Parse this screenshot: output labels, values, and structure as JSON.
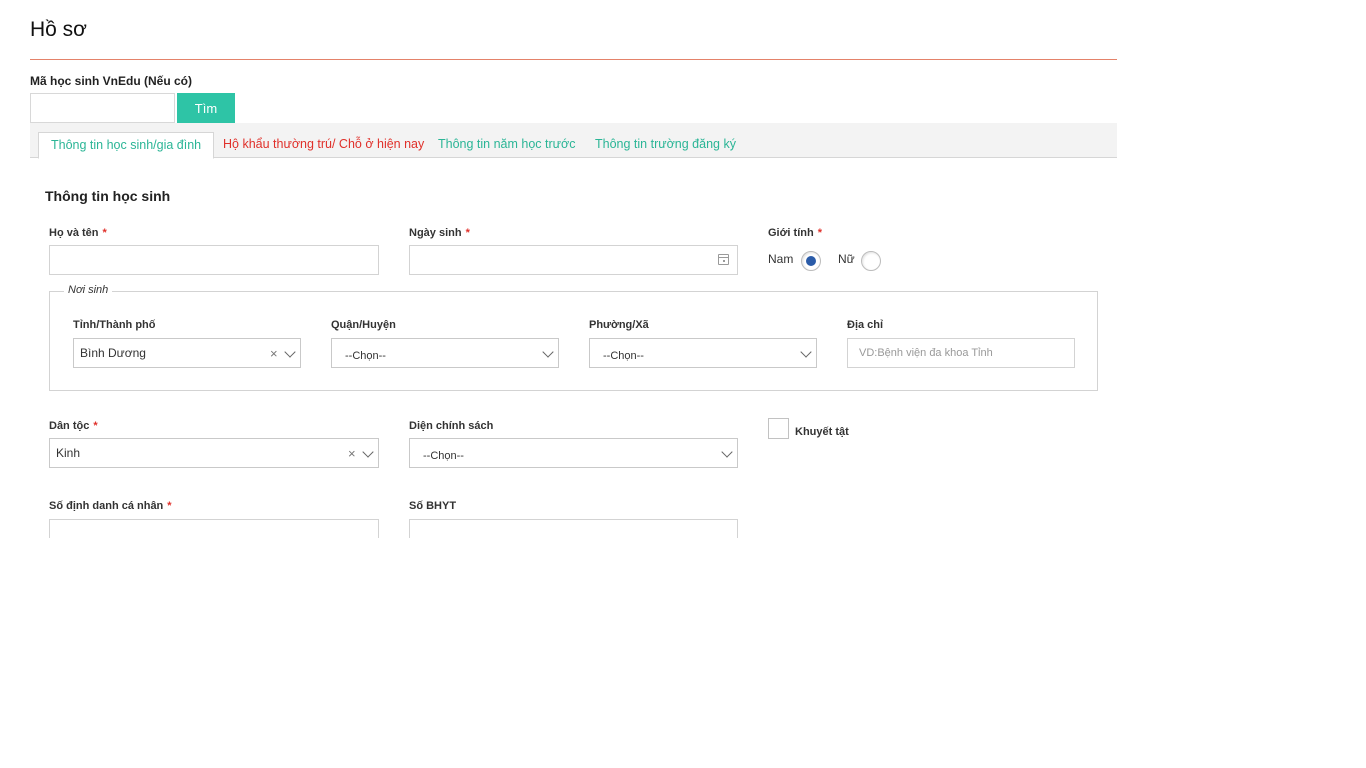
{
  "page": {
    "title": "Hồ sơ"
  },
  "search": {
    "label": "Mã học sinh VnEdu (Nếu có)",
    "value": "",
    "placeholder": "",
    "button_label": "Tìm"
  },
  "tabs": [
    {
      "label": "Thông tin học sinh/gia đình",
      "active": true
    },
    {
      "label": "Hộ khẩu thường trú/ Chỗ ở hiện nay",
      "active": false,
      "color": "#e0302a"
    },
    {
      "label": "Thông tin năm học trước",
      "active": false
    },
    {
      "label": "Thông tin trường đăng ký",
      "active": false
    }
  ],
  "student": {
    "section_title": "Thông tin học sinh",
    "full_name": {
      "label": "Họ và tên",
      "required": "*",
      "value": ""
    },
    "birth_date": {
      "label": "Ngày sinh",
      "required": "*",
      "value": ""
    },
    "gender": {
      "label": "Giới tính",
      "required": "*",
      "options": [
        "Nam",
        "Nữ"
      ],
      "selected": "Nam"
    },
    "birthplace": {
      "legend": "Nơi sinh",
      "province": {
        "label": "Tỉnh/Thành phố",
        "value": "Bình Dương",
        "clear": "×"
      },
      "district": {
        "label": "Quận/Huyện",
        "value": "--Chọn--"
      },
      "ward": {
        "label": "Phường/Xã",
        "value": "--Chọn--"
      },
      "address": {
        "label": "Địa chỉ",
        "value": "",
        "placeholder": "VD:Bệnh viện đa khoa Tỉnh"
      }
    },
    "ethnicity": {
      "label": "Dân tộc",
      "required": "*",
      "value": "Kinh",
      "clear": "×"
    },
    "policy": {
      "label": "Diện chính sách",
      "value": "--Chọn--"
    },
    "disability": {
      "label": "Khuyết tật",
      "checked": false
    },
    "personal_id": {
      "label": "Số định danh cá nhân",
      "required": "*",
      "value": ""
    },
    "health_insurance": {
      "label": "Số BHYT",
      "value": ""
    }
  },
  "colors": {
    "accent": "#2ec4a6",
    "tab_text": "#2bb596",
    "required": "#e0302a",
    "title_rule": "#e4826a",
    "radio_checked": "#2a5ba8"
  }
}
